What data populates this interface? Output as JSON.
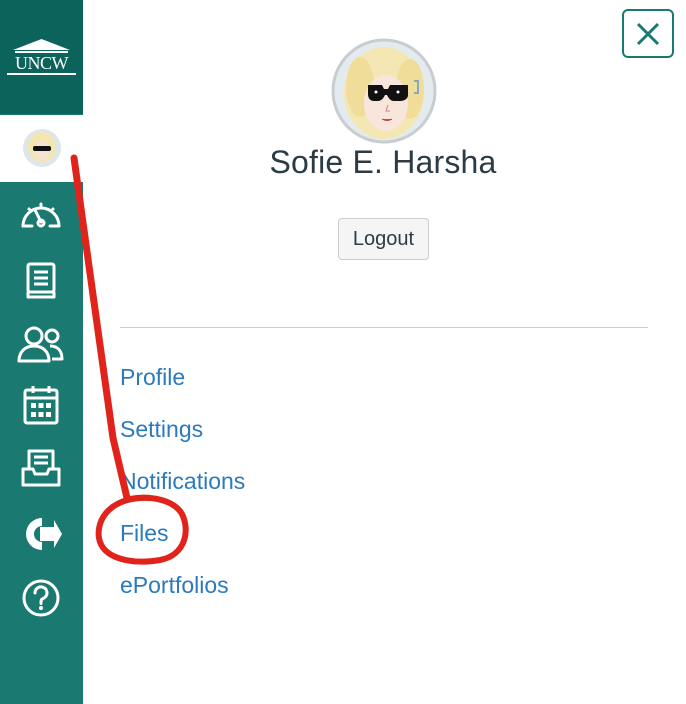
{
  "nav": {
    "logo_text": "UNCW",
    "items": [
      {
        "icon": "account-avatar-icon"
      },
      {
        "icon": "dashboard-icon"
      },
      {
        "icon": "courses-icon"
      },
      {
        "icon": "groups-icon"
      },
      {
        "icon": "calendar-icon"
      },
      {
        "icon": "inbox-icon"
      },
      {
        "icon": "commons-icon"
      },
      {
        "icon": "help-icon"
      }
    ]
  },
  "tray": {
    "close_icon": "close-icon",
    "user_name": "Sofie E. Harsha",
    "logout_label": "Logout",
    "links": [
      "Profile",
      "Settings",
      "Notifications",
      "Files",
      "ePortfolios"
    ]
  },
  "colors": {
    "nav_bg": "#1a7a72",
    "logo_bg": "#0b635b",
    "link": "#2b7abc",
    "annotation": "#e0241b"
  }
}
